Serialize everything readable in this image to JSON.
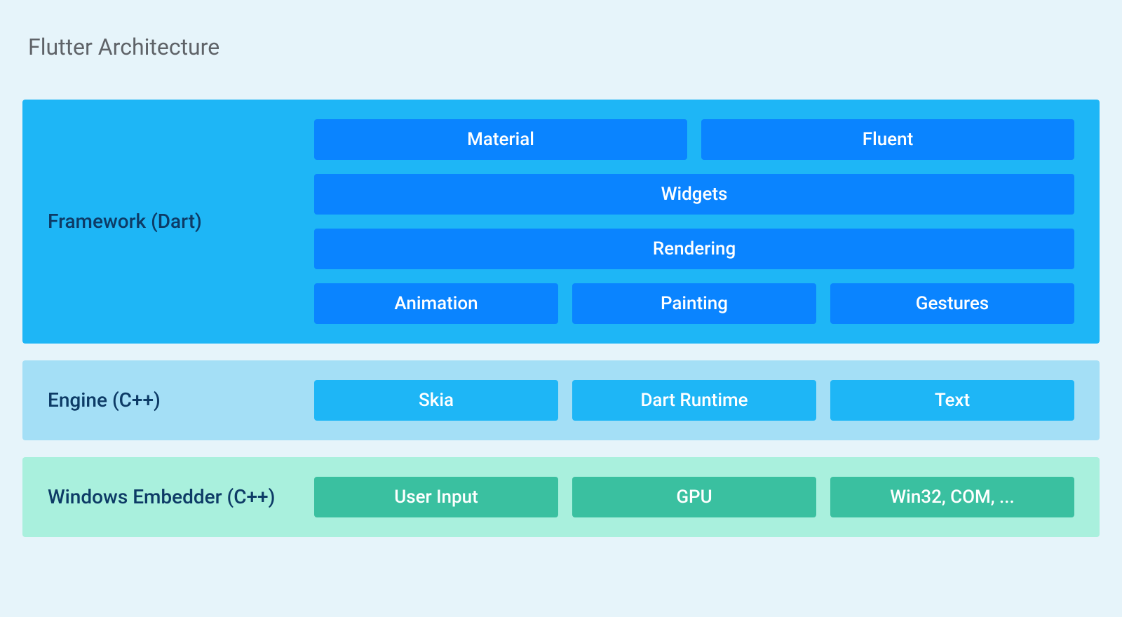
{
  "title": "Flutter Architecture",
  "layers": {
    "framework": {
      "label": "Framework (Dart)",
      "row0": {
        "box0": "Material",
        "box1": "Fluent"
      },
      "row1": {
        "box0": "Widgets"
      },
      "row2": {
        "box0": "Rendering"
      },
      "row3": {
        "box0": "Animation",
        "box1": "Painting",
        "box2": "Gestures"
      }
    },
    "engine": {
      "label": "Engine (C++)",
      "row0": {
        "box0": "Skia",
        "box1": "Dart Runtime",
        "box2": "Text"
      }
    },
    "embedder": {
      "label": "Windows Embedder (C++)",
      "row0": {
        "box0": "User Input",
        "box1": "GPU",
        "box2": "Win32, COM, ..."
      }
    }
  }
}
